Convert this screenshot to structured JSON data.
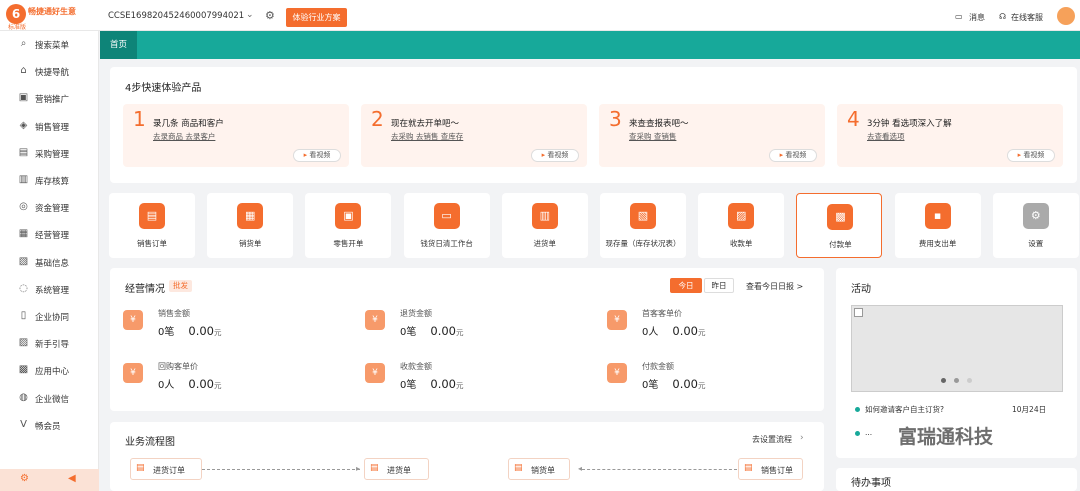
{
  "header": {
    "logo_mark": "6",
    "brand": "畅捷通好生意",
    "edition": "标准版",
    "account": "CCSE169820452460007994021",
    "try_button": "体验行业方案",
    "messages": "消息",
    "support": "在线客服"
  },
  "sidebar": {
    "items": [
      {
        "label": "搜索菜单",
        "icon": "search-menu-icon",
        "glyph": "⌕"
      },
      {
        "label": "快捷导航",
        "icon": "home-icon",
        "glyph": "⌂"
      },
      {
        "label": "营销推广",
        "icon": "gift-icon",
        "glyph": "▣"
      },
      {
        "label": "销售管理",
        "icon": "basket-icon",
        "glyph": "◈"
      },
      {
        "label": "采购管理",
        "icon": "truck-icon",
        "glyph": "▤"
      },
      {
        "label": "库存核算",
        "icon": "warehouse-icon",
        "glyph": "▥"
      },
      {
        "label": "资金管理",
        "icon": "money-icon",
        "glyph": "◎"
      },
      {
        "label": "经营管理",
        "icon": "clipboard-icon",
        "glyph": "▦"
      },
      {
        "label": "基础信息",
        "icon": "info-card-icon",
        "glyph": "▧"
      },
      {
        "label": "系统管理",
        "icon": "dots-circle-icon",
        "glyph": "◌"
      },
      {
        "label": "企业协同",
        "icon": "document-icon",
        "glyph": "▯"
      },
      {
        "label": "新手引导",
        "icon": "guide-icon",
        "glyph": "▨"
      },
      {
        "label": "应用中心",
        "icon": "calendar-icon",
        "glyph": "▩"
      },
      {
        "label": "企业微信",
        "icon": "wechat-icon",
        "glyph": "◍"
      },
      {
        "label": "畅会员",
        "icon": "vip-icon",
        "glyph": "V"
      }
    ]
  },
  "tabs": {
    "home": "首页"
  },
  "quickstart": {
    "title": "4步快速体验产品",
    "steps": [
      {
        "num": "1",
        "title": "录几条 商品和客户",
        "links": "去录商品  去录客户",
        "video": "看视频"
      },
      {
        "num": "2",
        "title": "现在就去开单吧～",
        "links": "去采购  去销售  查库存",
        "video": "看视频"
      },
      {
        "num": "3",
        "title": "来查查报表吧～",
        "links": "查采购  查销售",
        "video": "看视频"
      },
      {
        "num": "4",
        "title": "3分钟 看选项深入了解",
        "links": "去查看选项",
        "video": "看视频"
      }
    ]
  },
  "quick_actions": [
    {
      "label": "销售订单",
      "icon": "sales-order-icon"
    },
    {
      "label": "销货单",
      "icon": "sales-slip-icon"
    },
    {
      "label": "零售开单",
      "icon": "retail-icon"
    },
    {
      "label": "钱货日清工作台",
      "icon": "cashier-icon"
    },
    {
      "label": "进货单",
      "icon": "purchase-slip-icon"
    },
    {
      "label": "现存量（库存状况表）",
      "icon": "stock-icon"
    },
    {
      "label": "收款单",
      "icon": "receipt-icon"
    },
    {
      "label": "付款单",
      "icon": "payment-icon"
    },
    {
      "label": "费用支出单",
      "icon": "expense-icon"
    },
    {
      "label": "设置",
      "icon": "settings-icon"
    }
  ],
  "business": {
    "title": "经营情况",
    "badge": "批发",
    "today": "今日",
    "yesterday": "昨日",
    "daily_report": "查看今日日报 >",
    "stats": [
      {
        "label": "销售金额",
        "count": "0笔",
        "amount": "0.00",
        "unit": "元",
        "icon": "wallet-icon"
      },
      {
        "label": "退货金额",
        "count": "0笔",
        "amount": "0.00",
        "unit": "元",
        "icon": "return-icon"
      },
      {
        "label": "首客客单价",
        "count": "0人",
        "amount": "0.00",
        "unit": "元",
        "icon": "customer-icon"
      },
      {
        "label": "回购客单价",
        "count": "0人",
        "amount": "0.00",
        "unit": "元",
        "icon": "repurchase-icon"
      },
      {
        "label": "收款金额",
        "count": "0笔",
        "amount": "0.00",
        "unit": "元",
        "icon": "receive-icon"
      },
      {
        "label": "付款金额",
        "count": "0笔",
        "amount": "0.00",
        "unit": "元",
        "icon": "pay-icon"
      }
    ]
  },
  "flowchart": {
    "title": "业务流程图",
    "settings": "去设置流程",
    "nodes": [
      "进货订单",
      "进货单",
      "销货单",
      "销售订单"
    ]
  },
  "activity": {
    "title": "活动",
    "items": [
      {
        "text": "如何邀请客户自主订货?",
        "date": "10月24日"
      },
      {
        "text": "..."
      }
    ]
  },
  "todo": {
    "title": "待办事项"
  },
  "watermark": "富瑞通科技",
  "colors": {
    "accent": "#f46d2e",
    "teal": "#17a99a"
  }
}
